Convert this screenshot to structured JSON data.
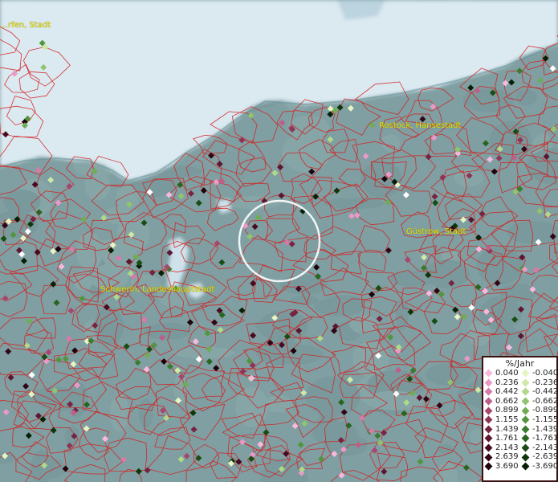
{
  "map": {
    "legend_title": "%/Jahr",
    "legend_positive": [
      {
        "label": "0.040",
        "color": "#f7b9df"
      },
      {
        "label": "0.236",
        "color": "#ea98c8"
      },
      {
        "label": "0.442",
        "color": "#d67aa9"
      },
      {
        "label": "0.662",
        "color": "#bf5e8a"
      },
      {
        "label": "0.899",
        "color": "#a7476f"
      },
      {
        "label": "1.155",
        "color": "#8e3457"
      },
      {
        "label": "1.439",
        "color": "#762442"
      },
      {
        "label": "1.761",
        "color": "#5e1530"
      },
      {
        "label": "2.143",
        "color": "#470a20"
      },
      {
        "label": "2.639",
        "color": "#320514"
      },
      {
        "label": "3.690",
        "color": "#1d020a"
      }
    ],
    "legend_negative": [
      {
        "label": "-0.040",
        "color": "#e6f5c3"
      },
      {
        "label": "-0.236",
        "color": "#cfe9a6"
      },
      {
        "label": "-0.442",
        "color": "#b0d98a"
      },
      {
        "label": "-0.662",
        "color": "#90c46e"
      },
      {
        "label": "-0.899",
        "color": "#6fad55"
      },
      {
        "label": "-1.155",
        "color": "#52953f"
      },
      {
        "label": "-1.439",
        "color": "#3b7c2e"
      },
      {
        "label": "-1.761",
        "color": "#28651f"
      },
      {
        "label": "-2.143",
        "color": "#184d13"
      },
      {
        "label": "-2.639",
        "color": "#0d370a"
      },
      {
        "label": "-3.690",
        "color": "#052005"
      }
    ],
    "cities": [
      {
        "name": "Rostock, Hansestadt"
      },
      {
        "name": "Güstrow, Stadt"
      },
      {
        "name": "Schwerin, Landeshauptstadt"
      },
      {
        "name": "…rfen, Stadt"
      }
    ],
    "colors": {
      "sea": "#dbe9f1",
      "land": "#7f9fa2",
      "boundary": "#d42020",
      "label": "#e8e000",
      "selection": "#ffffff"
    }
  }
}
